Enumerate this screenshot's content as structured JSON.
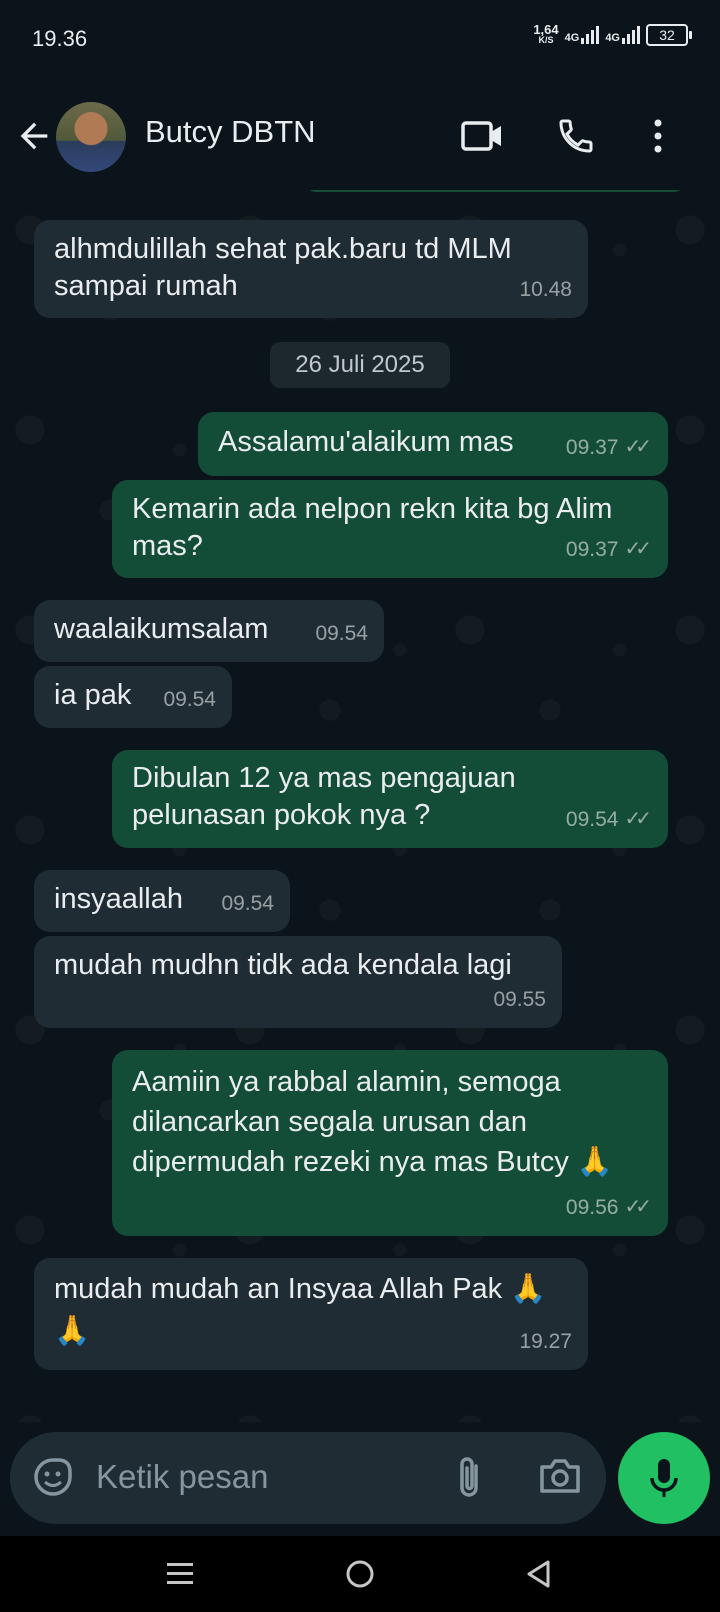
{
  "status_bar": {
    "time": "19.36",
    "speed_value": "1,64",
    "speed_unit": "K/S",
    "network1": "4G",
    "network2": "4G",
    "battery": "32"
  },
  "header": {
    "contact_name": "Butcy DBTN"
  },
  "chat": {
    "date_separator": "26 Juli 2025",
    "messages": [
      {
        "direction": "in",
        "text": "alhmdulillah sehat pak.baru td MLM sampai rumah",
        "time": "10.48"
      },
      {
        "direction": "out",
        "text": "Assalamu'alaikum mas",
        "time": "09.37"
      },
      {
        "direction": "out",
        "text": "Kemarin ada nelpon rekn kita bg Alim mas?",
        "time": "09.37"
      },
      {
        "direction": "in",
        "text": "waalaikumsalam",
        "time": "09.54"
      },
      {
        "direction": "in",
        "text": "ia pak",
        "time": "09.54"
      },
      {
        "direction": "out",
        "text": "Dibulan 12 ya mas pengajuan pelunasan pokok nya ?",
        "time": "09.54"
      },
      {
        "direction": "in",
        "text": "insyaallah",
        "time": "09.54"
      },
      {
        "direction": "in",
        "text": "mudah mudhn tidk ada kendala lagi",
        "time": "09.55"
      },
      {
        "direction": "out",
        "text": "Aamiin ya rabbal alamin, semoga dilancarkan segala urusan dan dipermudah rezeki nya mas Butcy 🙏",
        "time": "09.56"
      },
      {
        "direction": "in",
        "text": "mudah mudah an Insyaa Allah Pak 🙏🙏",
        "time": "19.27"
      }
    ]
  },
  "input": {
    "placeholder": "Ketik pesan"
  },
  "icons": {
    "back": "arrow-left-icon",
    "video": "video-call-icon",
    "call": "phone-icon",
    "menu": "more-vert-icon",
    "emoji": "sticker-emoji-icon",
    "attach": "paperclip-icon",
    "camera": "camera-icon",
    "mic": "microphone-icon",
    "read": "double-check-icon"
  },
  "colors": {
    "background": "#0b141a",
    "incoming_bubble": "#202c33",
    "outgoing_bubble": "#144d37",
    "mic_button": "#21c063"
  }
}
